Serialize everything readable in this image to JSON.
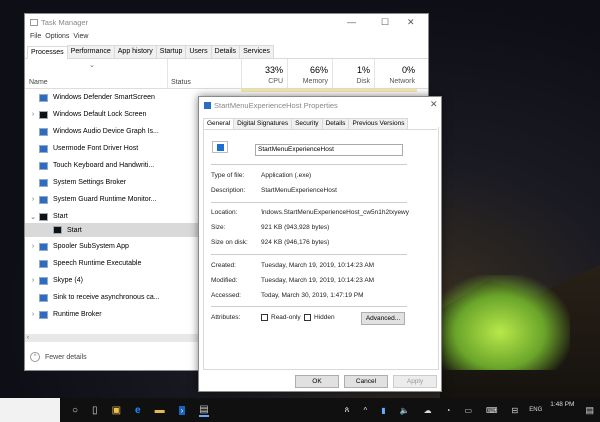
{
  "taskmanager": {
    "title": "Task Manager",
    "menu": [
      "File",
      "Options",
      "View"
    ],
    "tabs": [
      "Processes",
      "Performance",
      "App history",
      "Startup",
      "Users",
      "Details",
      "Services"
    ],
    "columns": {
      "name": "Name",
      "status": "Status",
      "cpu": {
        "pct": "33%",
        "label": "CPU"
      },
      "memory": {
        "pct": "66%",
        "label": "Memory"
      },
      "disk": {
        "pct": "1%",
        "label": "Disk"
      },
      "network": {
        "pct": "0%",
        "label": "Network"
      }
    },
    "rows": [
      {
        "name": "Windows Defender SmartScreen",
        "expand": ""
      },
      {
        "name": "Windows Default Lock Screen",
        "expand": ">"
      },
      {
        "name": "Windows Audio Device Graph Is...",
        "expand": ""
      },
      {
        "name": "Usermode Font Driver Host",
        "expand": ""
      },
      {
        "name": "Touch Keyboard and Handwriti...",
        "expand": ""
      },
      {
        "name": "System Settings Broker",
        "expand": ""
      },
      {
        "name": "System Guard Runtime Monitor...",
        "expand": ">"
      },
      {
        "name": "Start",
        "expand": "v"
      },
      {
        "name": "Start",
        "expand": "",
        "child": true,
        "selected": true
      },
      {
        "name": "Spooler SubSystem App",
        "expand": ">"
      },
      {
        "name": "Speech Runtime Executable",
        "expand": ""
      },
      {
        "name": "Skype (4)",
        "expand": ">"
      },
      {
        "name": "Sink to receive asynchronous ca...",
        "expand": ""
      },
      {
        "name": "Runtime Broker",
        "expand": ">"
      }
    ],
    "fewer_details": "Fewer details"
  },
  "properties": {
    "title": "StartMenuExperienceHost Properties",
    "tabs": [
      "General",
      "Digital Signatures",
      "Security",
      "Details",
      "Previous Versions"
    ],
    "name_value": "StartMenuExperienceHost",
    "type_label": "Type of file:",
    "type_value": "Application (.exe)",
    "desc_label": "Description:",
    "desc_value": "StartMenuExperienceHost",
    "loc_label": "Location:",
    "loc_value": "Windows.StartMenuExperienceHost_cw5n1h2txyewy",
    "size_label": "Size:",
    "size_value": "921 KB (943,928 bytes)",
    "disk_label": "Size on disk:",
    "disk_value": "924 KB (946,176 bytes)",
    "created_label": "Created:",
    "created_value": "Tuesday, March 19, 2019, 10:14:23 AM",
    "modified_label": "Modified:",
    "modified_value": "Tuesday, March 19, 2019, 10:14:23 AM",
    "accessed_label": "Accessed:",
    "accessed_value": "Today, March 30, 2019, 1:47:19 PM",
    "attr_label": "Attributes:",
    "readonly": "Read-only",
    "hidden": "Hidden",
    "advanced": "Advanced...",
    "ok": "OK",
    "cancel": "Cancel",
    "apply": "Apply"
  },
  "taskbar": {
    "lang": "ENG",
    "time": "1:48 PM"
  }
}
